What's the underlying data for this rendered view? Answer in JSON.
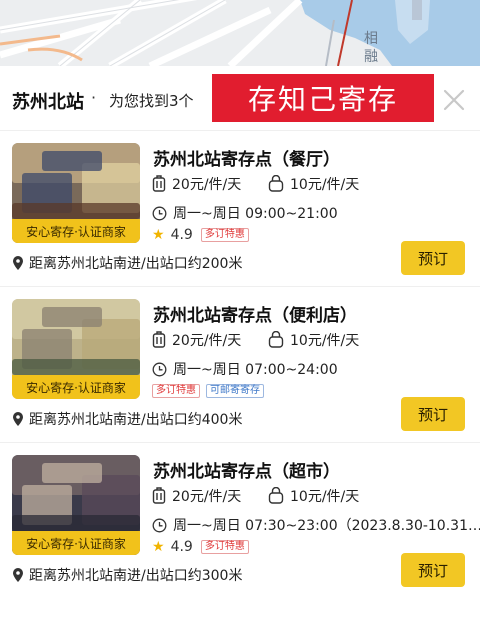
{
  "map": {
    "label": "相 融"
  },
  "header": {
    "station": "苏州北站",
    "separator": "·",
    "found_text": "为您找到3个",
    "banner": "存知己寄存"
  },
  "listings": [
    {
      "title": "苏州北站寄存点（餐厅）",
      "badge": "安心寄存·认证商家",
      "price_large": "20元/件/天",
      "price_small": "10元/件/天",
      "hours": "周一~周日 09:00~21:00",
      "rating": "4.9",
      "tags": [
        "多订特惠"
      ],
      "distance": "距离苏州北站南进/出站口约200米",
      "button": "预订"
    },
    {
      "title": "苏州北站寄存点（便利店）",
      "badge": "安心寄存·认证商家",
      "price_large": "20元/件/天",
      "price_small": "10元/件/天",
      "hours": "周一~周日 07:00~24:00",
      "rating": "",
      "tags": [
        "多订特惠",
        "可邮寄寄存"
      ],
      "distance": "距离苏州北站南进/出站口约400米",
      "button": "预订"
    },
    {
      "title": "苏州北站寄存点（超市）",
      "badge": "安心寄存·认证商家",
      "price_large": "20元/件/天",
      "price_small": "10元/件/天",
      "hours": "周一~周日 07:30~23:00（2023.8.30-10.31…",
      "rating": "4.9",
      "tags": [
        "多订特惠"
      ],
      "distance": "距离苏州北站南进/出站口约300米",
      "button": "预订"
    }
  ],
  "colors": {
    "accent_yellow": "#f2c724",
    "banner_red": "#e11d2f",
    "tag_red": "#e03a3a",
    "tag_blue": "#3f78c8"
  },
  "icons": {
    "close": "close-icon",
    "luggage": "luggage-icon",
    "bag": "bag-icon",
    "clock": "clock-icon",
    "star": "star-icon",
    "location": "location-pin-icon"
  }
}
